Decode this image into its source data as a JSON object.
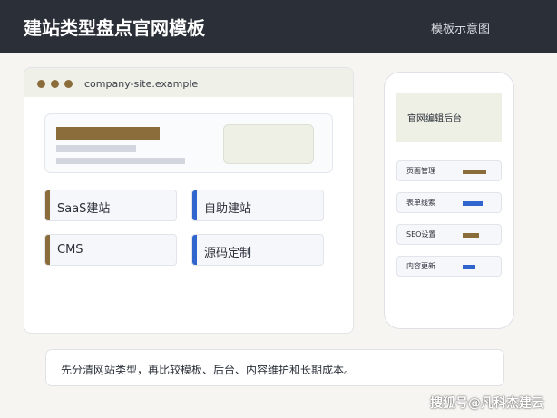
{
  "header": {
    "title": "建站类型盘点官网模板",
    "subtitle": "模板示意图"
  },
  "browser": {
    "url": "company-site.example",
    "cards": [
      {
        "label": "SaaS建站",
        "accent": "#8a6d3b"
      },
      {
        "label": "自助建站",
        "accent": "#2f65cc"
      },
      {
        "label": "CMS",
        "accent": "#8a6d3b"
      },
      {
        "label": "源码定制",
        "accent": "#2f65cc"
      }
    ]
  },
  "phone": {
    "header_label": "官网编辑后台",
    "rows": [
      {
        "label": "页面管理",
        "color": "#8a6d3b",
        "fill": 0.8
      },
      {
        "label": "表单线索",
        "color": "#2f65cc",
        "fill": 0.7
      },
      {
        "label": "SEO设置",
        "color": "#8a6d3b",
        "fill": 0.55
      },
      {
        "label": "内容更新",
        "color": "#2f65cc",
        "fill": 0.45
      }
    ]
  },
  "caption": "先分清网站类型，再比较模板、后台、内容维护和长期成本。",
  "watermark": "搜狐号@凡科杰建云"
}
